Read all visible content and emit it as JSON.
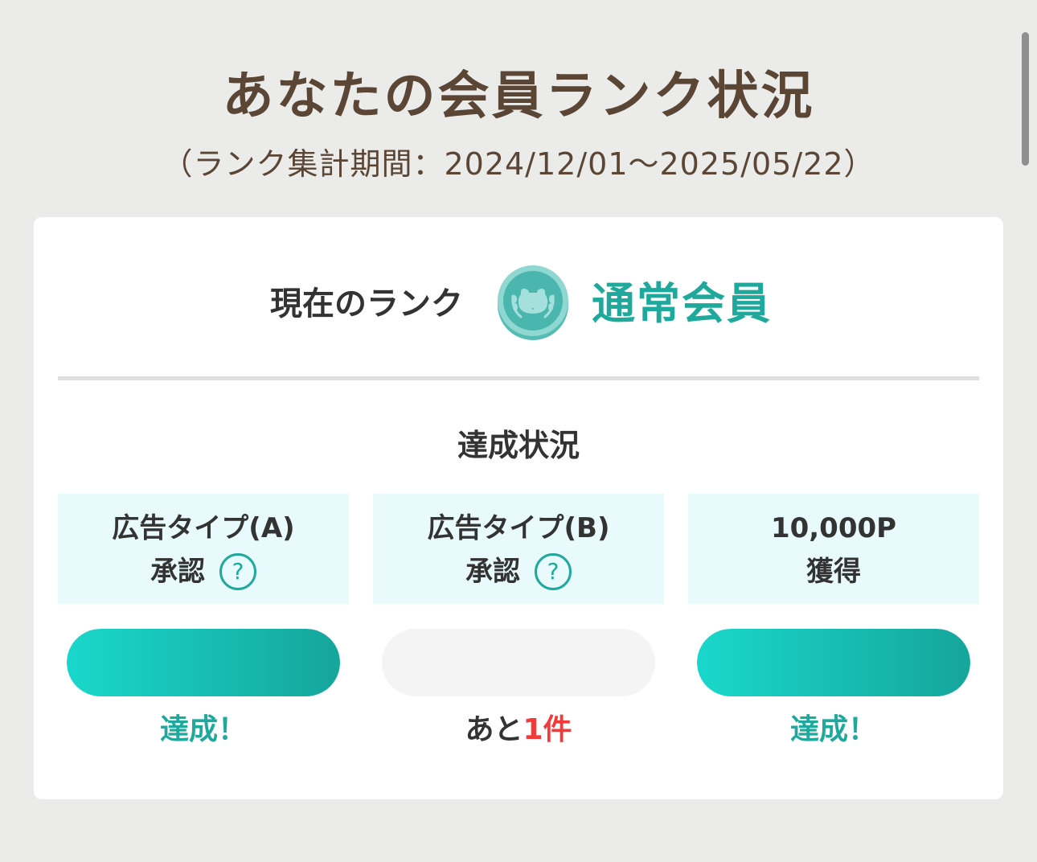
{
  "header": {
    "title": "あなたの会員ランク状況",
    "period": "（ランク集計期間：2024/12/01〜2025/05/22）"
  },
  "rank": {
    "label": "現在のランク",
    "name": "通常会員",
    "medal_icon": "hippo-medal-icon",
    "accent_color": "#1fa99c"
  },
  "achievement": {
    "title": "達成状況",
    "conditions": [
      {
        "line1": "広告タイプ(A)",
        "line2": "承認",
        "help_icon": "question-circle-icon",
        "help_symbol": "?",
        "progress": 1.0,
        "status": "達成！"
      },
      {
        "line1": "広告タイプ(B)",
        "line2": "承認",
        "help_icon": "question-circle-icon",
        "help_symbol": "?",
        "progress": 0.0,
        "status_prefix": "あと",
        "status_count": "1件"
      },
      {
        "line1": "10,000P",
        "line2": "獲得",
        "progress": 1.0,
        "status": "達成！"
      }
    ]
  },
  "colors": {
    "background": "#ebebea",
    "title_brown": "#5b4636",
    "teal": "#1fa99c",
    "remaining_red": "#f23a3a"
  }
}
